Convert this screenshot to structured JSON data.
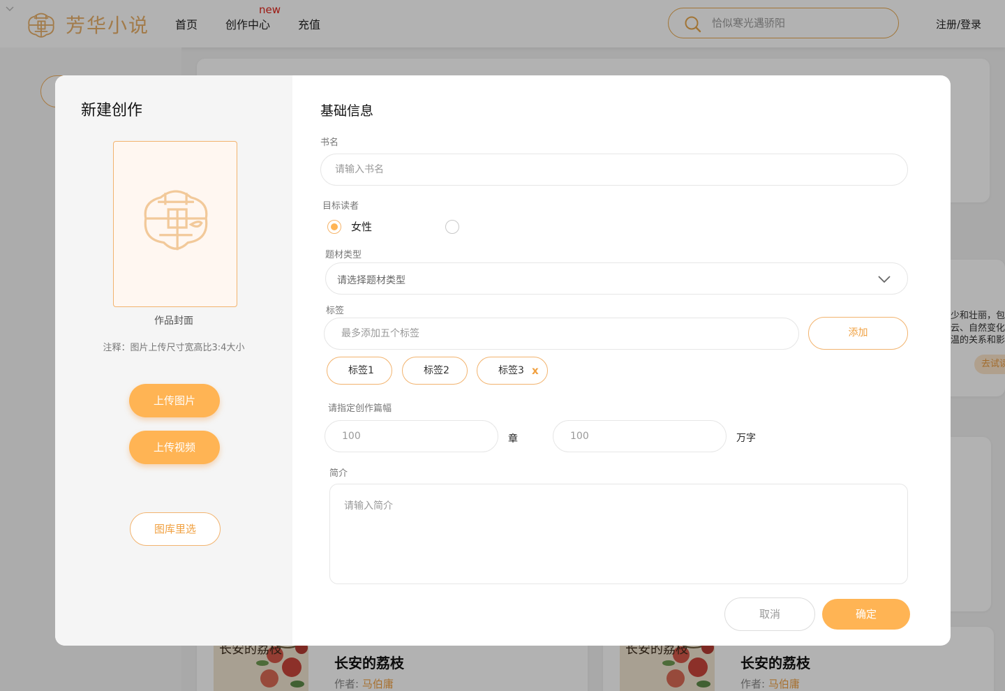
{
  "header": {
    "logo_text": "芳华小说",
    "nav": [
      {
        "label": "首页"
      },
      {
        "label": "创作中心",
        "badge": "new"
      },
      {
        "label": "充值"
      }
    ],
    "search_placeholder": "恰似寒光遇骄阳",
    "login_label": "注册/登录"
  },
  "background": {
    "snippet_lines": [
      "少和壮丽，包括",
      "云、自然变化等",
      "温的关系和影响"
    ],
    "try_button": "去试读",
    "books": [
      {
        "cover_text": "长安的荔枝",
        "title": "长安的荔枝",
        "author_label": "作者:",
        "author": "马伯庸"
      },
      {
        "cover_text": "长安的荔枝",
        "title": "长安的荔枝",
        "author_label": "作者:",
        "author": "马伯庸"
      }
    ]
  },
  "modal": {
    "title": "新建创作",
    "cover_label": "作品封面",
    "cover_note": "注释：图片上传尺寸宽高比3:4大小",
    "upload_image": "上传图片",
    "upload_video": "上传视频",
    "gallery_pick": "图库里选",
    "section_title": "基础信息",
    "book_name": {
      "label": "书名",
      "placeholder": "请输入书名",
      "value": ""
    },
    "audience": {
      "label": "目标读者",
      "options": [
        {
          "label": "女性",
          "checked": true
        },
        {
          "label": "",
          "checked": false
        }
      ]
    },
    "genre": {
      "label": "题材类型",
      "placeholder": "请选择题材类型"
    },
    "tags": {
      "label": "标签",
      "placeholder": "最多添加五个标签",
      "add_button": "添加",
      "items": [
        "标签1",
        "标签2",
        "标签3"
      ],
      "remove_glyph": "x"
    },
    "length": {
      "label": "请指定创作篇幅",
      "chapters_placeholder": "100",
      "chapters_unit": "章",
      "words_placeholder": "100",
      "words_unit": "万字"
    },
    "intro": {
      "label": "简介",
      "placeholder": "请输入简介"
    },
    "cancel_button": "取消",
    "confirm_button": "确定"
  },
  "colors": {
    "accent": "#ffb454",
    "accent_border": "#f2b36e",
    "badge": "#e0251b"
  }
}
